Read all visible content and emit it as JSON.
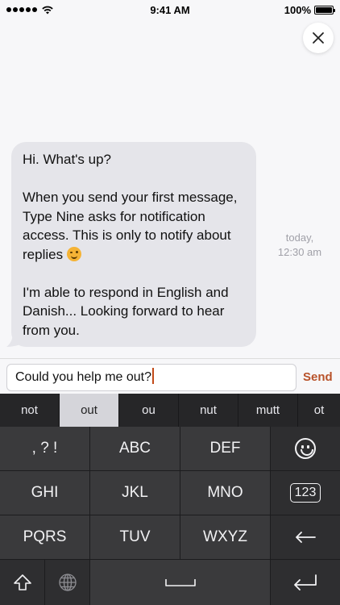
{
  "status_bar": {
    "time": "9:41 AM",
    "battery": "100%"
  },
  "chat": {
    "messages": [
      {
        "paragraphs": [
          "Hi. What's up?",
          "When you send your first message, Type Nine asks for notification access. This is only to notify about replies",
          "I'm able to respond in English and Danish... Looking forward to hear from you."
        ],
        "emoji": "winking-face"
      }
    ],
    "timestamp_day": "today,",
    "timestamp_time": "12:30 am"
  },
  "composer": {
    "value": "Could you help me out?",
    "send_label": "Send"
  },
  "keyboard": {
    "suggestions": [
      "not",
      "out",
      "ou",
      "nut",
      "mutt",
      "ot"
    ],
    "active_suggestion": "out",
    "rows": [
      [
        ",?!",
        "ABC",
        "DEF",
        "emoji-icon"
      ],
      [
        "GHI",
        "JKL",
        "MNO",
        "123"
      ],
      [
        "PQRS",
        "TUV",
        "WXYZ",
        "backspace-icon"
      ],
      [
        "shift-icon",
        "globe-icon",
        "space-icon",
        "return-icon"
      ]
    ],
    "labels": {
      "punct": ", ? !",
      "abc": "ABC",
      "def": "DEF",
      "ghi": "GHI",
      "jkl": "JKL",
      "mno": "MNO",
      "num": "123",
      "pqrs": "PQRS",
      "tuv": "TUV",
      "wxyz": "WXYZ"
    }
  },
  "colors": {
    "accent": "#b8522a",
    "bubble": "#e5e5ea",
    "keyboard": "#2b2b2d",
    "active_suggestion": "#d5d5da"
  }
}
